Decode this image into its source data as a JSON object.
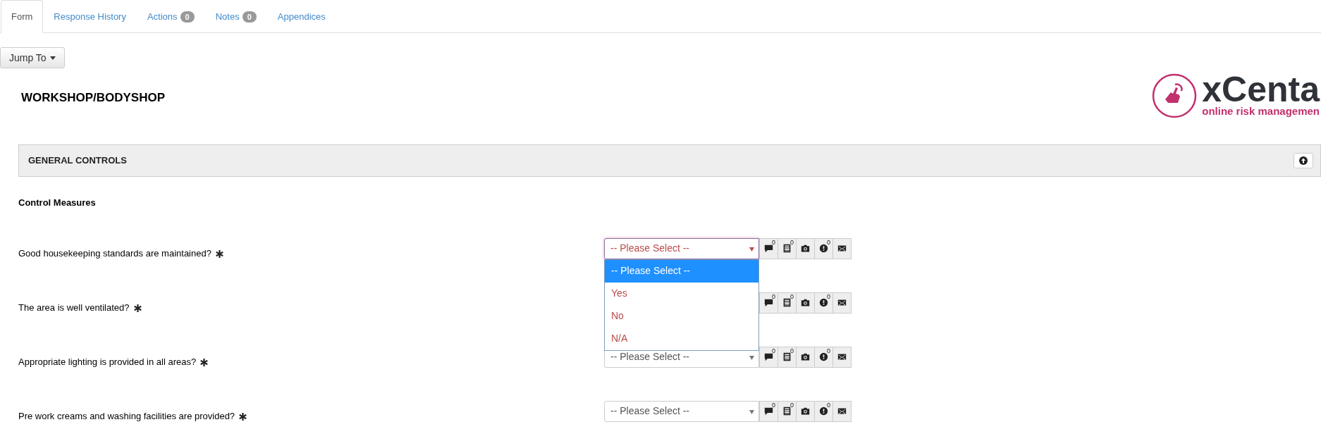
{
  "tabs": [
    {
      "label": "Form",
      "selected": true
    },
    {
      "label": "Response History",
      "selected": false
    },
    {
      "label": "Actions",
      "badge": "0",
      "selected": false
    },
    {
      "label": "Notes",
      "badge": "0",
      "selected": false
    },
    {
      "label": "Appendices",
      "selected": false
    }
  ],
  "jump_button": {
    "label": "Jump To"
  },
  "page_title": "WORKSHOP/BODYSHOP",
  "logo": {
    "name": "xCenta",
    "tagline": "online risk managemen"
  },
  "section": {
    "title": "GENERAL CONTROLS"
  },
  "subsection": "Control Measures",
  "questions": [
    {
      "text": "Good housekeeping standards are maintained?",
      "select": {
        "value": "-- Please Select --",
        "focused": true,
        "open": true
      },
      "counts": {
        "comment": "0",
        "list": "0",
        "alert": "0"
      }
    },
    {
      "text": "The area is well ventilated?",
      "counts": {
        "comment": "0",
        "list": "0",
        "alert": "0"
      }
    },
    {
      "text": "Appropriate lighting is provided in all areas?",
      "select": {
        "value": "-- Please Select --",
        "focused": false
      },
      "counts": {
        "comment": "0",
        "list": "0",
        "alert": "0"
      }
    },
    {
      "text": "Pre work creams and washing facilities are provided?",
      "select": {
        "value": "-- Please Select --",
        "focused": false
      },
      "counts": {
        "comment": "0",
        "list": "0",
        "alert": "0"
      }
    }
  ],
  "dropdown_options": [
    {
      "label": "-- Please Select --",
      "selected": true
    },
    {
      "label": "Yes",
      "selected": false
    },
    {
      "label": "No",
      "selected": false
    },
    {
      "label": "N/A",
      "selected": false
    }
  ]
}
